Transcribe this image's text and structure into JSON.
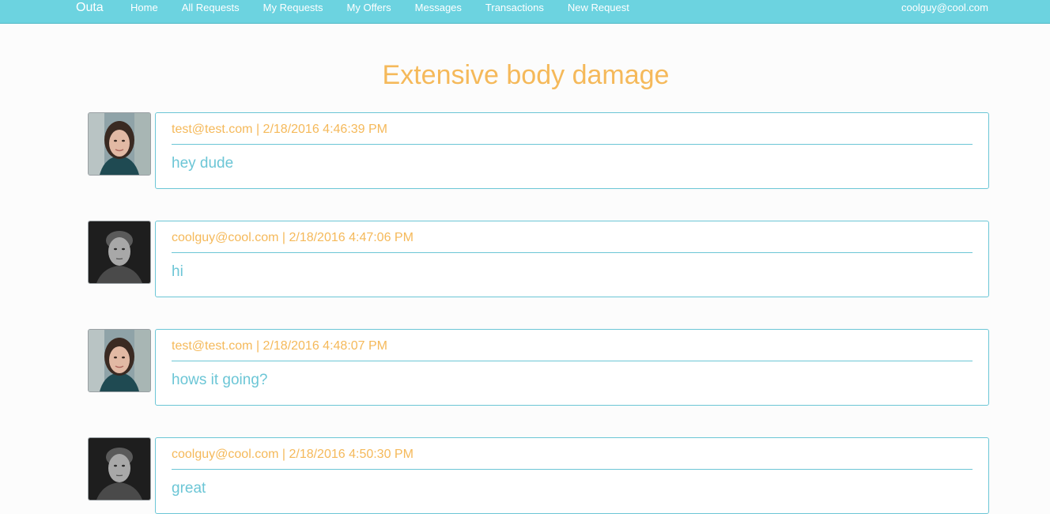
{
  "nav": {
    "brand": "Outa",
    "links": [
      "Home",
      "All Requests",
      "My Requests",
      "My Offers",
      "Messages",
      "Transactions",
      "New Request"
    ],
    "user": "coolguy@cool.com"
  },
  "page": {
    "title": "Extensive body damage"
  },
  "messages": [
    {
      "author": "test@test.com",
      "timestamp": "2/18/2016 4:46:39 PM",
      "text": "hey dude",
      "avatar": "woman-avatar"
    },
    {
      "author": "coolguy@cool.com",
      "timestamp": "2/18/2016 4:47:06 PM",
      "text": "hi",
      "avatar": "man-avatar"
    },
    {
      "author": "test@test.com",
      "timestamp": "2/18/2016 4:48:07 PM",
      "text": "hows it going?",
      "avatar": "woman-avatar"
    },
    {
      "author": "coolguy@cool.com",
      "timestamp": "2/18/2016 4:50:30 PM",
      "text": "great",
      "avatar": "man-avatar"
    }
  ],
  "colors": {
    "navbar": "#6cd3e0",
    "accent_orange": "#f5b95a",
    "accent_teal": "#6cc6d6"
  }
}
